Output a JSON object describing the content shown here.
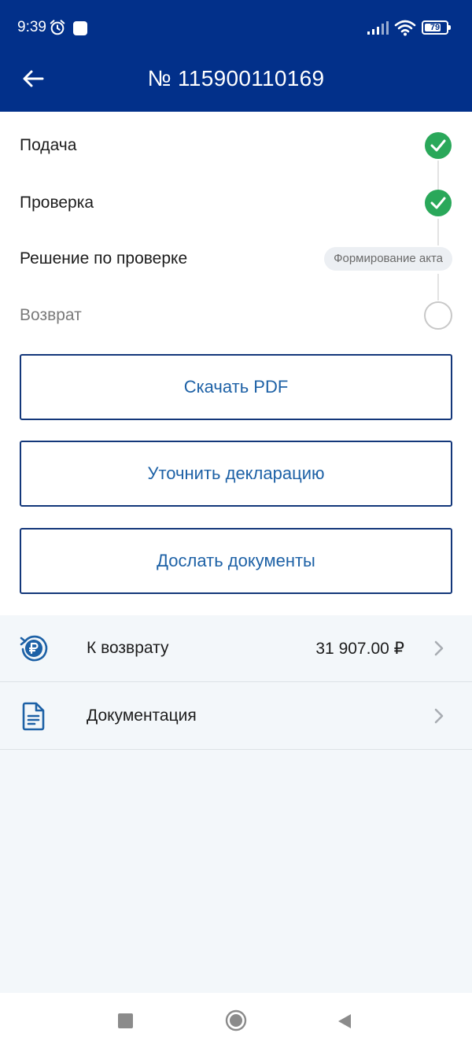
{
  "status_bar": {
    "time": "9:39",
    "battery": "79",
    "icons": [
      "alarm-icon",
      "app-notification-icon",
      "signal-icon",
      "wifi-icon",
      "battery-icon"
    ]
  },
  "header": {
    "back_icon": "arrow-left-icon",
    "title": "№ 115900110169"
  },
  "steps": [
    {
      "label": "Подача",
      "state": "done"
    },
    {
      "label": "Проверка",
      "state": "done"
    },
    {
      "label": "Решение по проверке",
      "state": "in-progress",
      "chip": "Формирование акта"
    },
    {
      "label": "Возврат",
      "state": "pending"
    }
  ],
  "actions": {
    "download_pdf": "Скачать PDF",
    "clarify_declaration": "Уточнить декларацию",
    "send_documents": "Дослать документы"
  },
  "list": {
    "refund": {
      "label": "К возврату",
      "value": "31 907.00 ₽",
      "icon": "ruble-refund-icon"
    },
    "documentation": {
      "label": "Документация",
      "icon": "document-icon"
    }
  },
  "colors": {
    "header_bg": "#02308a",
    "accent_text": "#1d61a6",
    "button_border": "#13377a",
    "success": "#2aa85a",
    "page_bg": "#f3f7fa"
  }
}
